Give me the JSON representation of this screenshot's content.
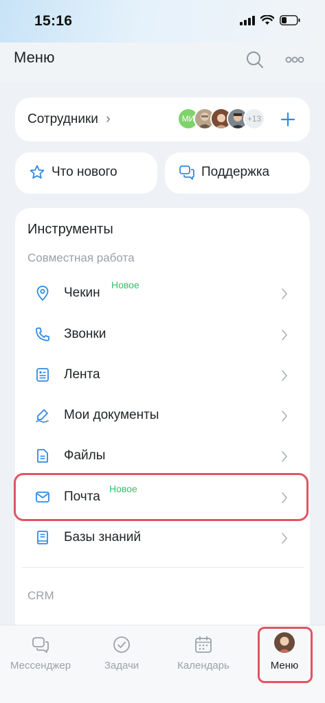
{
  "status_bar": {
    "time": "15:16"
  },
  "header": {
    "title": "Меню"
  },
  "employees": {
    "label": "Сотрудники",
    "chevron": "›",
    "avatar_initials": "МИ",
    "more_count": "+13"
  },
  "quick_actions": {
    "whats_new": "Что нового",
    "support": "Поддержка"
  },
  "tools": {
    "title": "Инструменты",
    "section_collab": "Совместная работа",
    "items": [
      {
        "label": "Чекин",
        "badge": "Новое",
        "icon": "location-pin-icon"
      },
      {
        "label": "Звонки",
        "badge": "",
        "icon": "phone-icon"
      },
      {
        "label": "Лента",
        "badge": "",
        "icon": "feed-icon"
      },
      {
        "label": "Мои документы",
        "badge": "",
        "icon": "document-sign-icon"
      },
      {
        "label": "Файлы",
        "badge": "",
        "icon": "file-icon"
      },
      {
        "label": "Почта",
        "badge": "Новое",
        "icon": "mail-icon"
      },
      {
        "label": "Базы знаний",
        "badge": "",
        "icon": "knowledge-base-icon"
      }
    ],
    "section_crm": "CRM"
  },
  "tabbar": {
    "messenger": "Мессенджер",
    "tasks": "Задачи",
    "calendar": "Календарь",
    "menu": "Меню"
  },
  "colors": {
    "accent": "#2e8ae6",
    "badge": "#2fc26b",
    "highlight": "#e05561"
  }
}
